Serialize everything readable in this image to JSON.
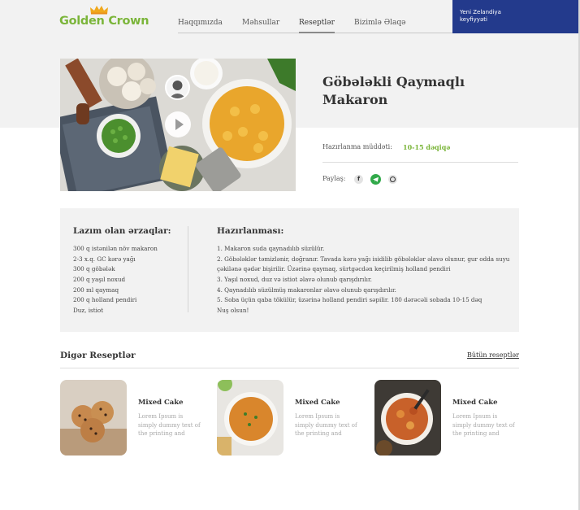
{
  "brand": {
    "name": "Golden Crown"
  },
  "nav": {
    "items": [
      {
        "label": "Haqqımızda"
      },
      {
        "label": "Məhsullar"
      },
      {
        "label": "Reseptlər"
      },
      {
        "label": "Bizimlə Əlaqə"
      }
    ],
    "active": "Reseptlər"
  },
  "badge": {
    "line1": "Yeni Zelandiya",
    "line2": "keyfiyyəti"
  },
  "recipe": {
    "title": "Göbələkli Qaymaqlı Makaron",
    "prep_label": "Hazırlanma müddəti:",
    "prep_value": "10-15 dəqiqə",
    "share_label": "Paylaş:"
  },
  "share_icons": [
    "facebook-icon",
    "telegram-icon",
    "whatsapp-icon"
  ],
  "ingredients": {
    "title": "Lazım olan ərzaqlar:",
    "items": [
      "300 q istənilən növ makaron",
      "2-3 x.q. GC kərə yağı",
      "300 q göbələk",
      "200 q yaşıl noxud",
      "200 ml qaymaq",
      "200 q holland pendiri",
      "Duz, istiot"
    ]
  },
  "preparation": {
    "title": "Hazırlanması:",
    "steps": [
      "1. Makaron suda qaynadılıb süzülür.",
      "2. Göbələklər təmizlənir, doğranır. Tavada kərə yağı isidilib göbələklər əlavə olunur, gur odda suyu",
      "çəkilənə qədər bişirilir. Üzərinə qaymaq, sürtgəcdən keçirilmiş holland pendiri",
      "3. Yaşıl noxud, duz və istiot əlavə olunub qarışdırılır.",
      "4. Qaynadılıb süzülmüş makaronlar əlavə olunub qarışdırılır.",
      "5. Soba üçün qaba tökülür, üzərinə holland pendiri səpilir. 180 dərəcəli sobada 10-15 dəq",
      "Nuş olsun!"
    ]
  },
  "other": {
    "title": "Digər Reseptlər",
    "all_link": "Bütün reseptlər",
    "cards": [
      {
        "title": "Mixed Cake",
        "desc": "Lorem Ipsum is simply dummy text of the printing and"
      },
      {
        "title": "Mixed Cake",
        "desc": "Lorem Ipsum is simply dummy text of the printing and"
      },
      {
        "title": "Mixed Cake",
        "desc": "Lorem Ipsum is simply dummy text of the printing and"
      }
    ]
  },
  "colors": {
    "brand_green": "#7bb53a",
    "badge_blue": "#233a8c",
    "crown_gold": "#f0a81c",
    "panel_gray": "#f2f2f2"
  }
}
